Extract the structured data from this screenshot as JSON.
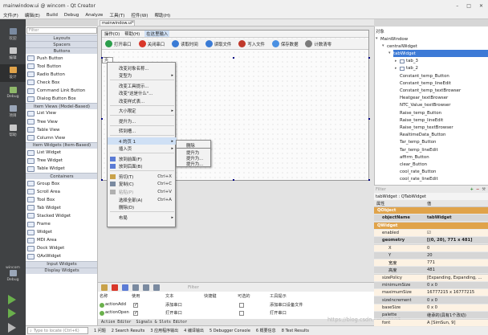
{
  "window": {
    "title": "mainwindow.ui @ wincom - Qt Creator"
  },
  "menubar": [
    "文件(F)",
    "编辑(E)",
    "Build",
    "Debug",
    "Analyze",
    "工具(T)",
    "控件(W)",
    "帮助(H)"
  ],
  "modes": [
    "欢迎",
    "编辑",
    "设计",
    "Debug",
    "项目",
    "帮助"
  ],
  "kit": {
    "project": "wincom",
    "config": "Debug"
  },
  "widgetbox": {
    "filter_placeholder": "Filter",
    "items": [
      {
        "t": "cat",
        "label": "Layouts"
      },
      {
        "t": "cat",
        "label": "Spacers"
      },
      {
        "t": "cat",
        "label": "Buttons"
      },
      {
        "t": "item",
        "label": "Push Button"
      },
      {
        "t": "item",
        "label": "Tool Button"
      },
      {
        "t": "item",
        "label": "Radio Button"
      },
      {
        "t": "item",
        "label": "Check Box"
      },
      {
        "t": "item",
        "label": "Command Link Button"
      },
      {
        "t": "item",
        "label": "Dialog Button Box"
      },
      {
        "t": "cat",
        "label": "Item Views (Model-Based)"
      },
      {
        "t": "item",
        "label": "List View"
      },
      {
        "t": "item",
        "label": "Tree View"
      },
      {
        "t": "item",
        "label": "Table View"
      },
      {
        "t": "item",
        "label": "Column View"
      },
      {
        "t": "cat",
        "label": "Item Widgets (Item-Based)"
      },
      {
        "t": "item",
        "label": "List Widget"
      },
      {
        "t": "item",
        "label": "Tree Widget"
      },
      {
        "t": "item",
        "label": "Table Widget"
      },
      {
        "t": "cat",
        "label": "Containers"
      },
      {
        "t": "item",
        "label": "Group Box"
      },
      {
        "t": "item",
        "label": "Scroll Area"
      },
      {
        "t": "item",
        "label": "Tool Box"
      },
      {
        "t": "item",
        "label": "Tab Widget"
      },
      {
        "t": "item",
        "label": "Stacked Widget"
      },
      {
        "t": "item",
        "label": "Frame"
      },
      {
        "t": "item",
        "label": "Widget"
      },
      {
        "t": "item",
        "label": "MDI Area"
      },
      {
        "t": "item",
        "label": "Dock Widget"
      },
      {
        "t": "item",
        "label": "QAxWidget"
      },
      {
        "t": "cat",
        "label": "Input Widgets"
      },
      {
        "t": "cat",
        "label": "Display Widgets"
      }
    ]
  },
  "editor": {
    "doc_tab": "mainwindow.ui*",
    "form_menu": [
      "操作(O)",
      "帮助(H)",
      "在这里输入"
    ],
    "form_toolbar": [
      "打开串口",
      "关闭串口",
      "读取时间",
      "读取文件",
      "写入文件",
      "保存数据",
      "计数清零"
    ],
    "tab_label": "页"
  },
  "context_menu": {
    "items": [
      {
        "label": "改变对象名称...",
        "y": 0
      },
      {
        "label": "变型为",
        "y": 1,
        "sub": true
      },
      {
        "sep": true,
        "y": 2
      },
      {
        "label": "改变工具提示...",
        "y": 2.3
      },
      {
        "label": "改变\"这是什么\"...",
        "y": 3.3
      },
      {
        "label": "改变样式表...",
        "y": 4.3
      },
      {
        "sep": true,
        "y": 5.3
      },
      {
        "label": "大小限定",
        "y": 5.6,
        "sub": true
      },
      {
        "sep": true,
        "y": 6.6
      },
      {
        "label": "提升为...",
        "y": 6.9
      },
      {
        "sep": true,
        "y": 7.9
      },
      {
        "label": "转到槽...",
        "y": 8.2
      },
      {
        "sep": true,
        "y": 9.2
      },
      {
        "label": "4 的页 1",
        "y": 9.5,
        "sub": true,
        "hl": true
      },
      {
        "label": "插入页",
        "y": 10.5,
        "sub": true
      },
      {
        "sep": true,
        "y": 11.5
      },
      {
        "label": "放到前面(F)",
        "y": 11.8
      },
      {
        "label": "放到后面(B)",
        "y": 12.8
      },
      {
        "sep": true,
        "y": 13.8
      },
      {
        "label": "剪切(T)",
        "y": 14.1,
        "sc": "Ctrl+X"
      },
      {
        "label": "复制(C)",
        "y": 15.1,
        "sc": "Ctrl+C"
      },
      {
        "label": "粘贴(P)",
        "y": 16.1,
        "sc": "Ctrl+V",
        "dis": true
      },
      {
        "label": "选择全部(A)",
        "y": 17.1,
        "sc": "Ctrl+A"
      },
      {
        "label": "删除(D)",
        "y": 18.1
      },
      {
        "sep": true,
        "y": 19.1
      },
      {
        "label": "布局",
        "y": 19.4,
        "sub": true
      }
    ],
    "sub1": [
      "删除"
    ],
    "sub2": [
      "提升为",
      "提升为...",
      "提升为..."
    ]
  },
  "action_editor": {
    "filter_placeholder": "Filter",
    "columns": [
      "名称",
      "使用",
      "文本",
      "快捷键",
      "可选的",
      "工具提示"
    ],
    "rows": [
      {
        "name": "actionAdd",
        "used": true,
        "text": "添加串口",
        "tip": "添加串口设备文件"
      },
      {
        "name": "actionOpen",
        "used": true,
        "text": "打开串口",
        "tip": "打开串口"
      }
    ],
    "tabs": [
      "Action Editor",
      "Signals & Slots Editor"
    ]
  },
  "statusbar": {
    "locate_placeholder": "Type to locate (Ctrl+K)",
    "items": [
      "1 问题",
      "2 Search Results",
      "3 应用程序输出",
      "4 编译输出",
      "5 Debugger Console",
      "6 概要信息",
      "8 Test Results"
    ]
  },
  "object_inspector": {
    "header": "对象",
    "tree": [
      {
        "label": "MainWindow",
        "depth": 0,
        "twisty": "▾"
      },
      {
        "label": "centralWidget",
        "depth": 1,
        "twisty": "▾"
      },
      {
        "label": "tabWidget",
        "depth": 2,
        "twisty": "▾",
        "sel": true
      },
      {
        "label": "tab_3",
        "depth": 3,
        "twisty": "▸"
      },
      {
        "label": "tab_2",
        "depth": 3,
        "twisty": "▸"
      },
      {
        "label": "Constant_temp_Button",
        "depth": 3
      },
      {
        "label": "Constant_temp_lineEdit",
        "depth": 3
      },
      {
        "label": "Constant_temp_textBrowser",
        "depth": 3
      },
      {
        "label": "Heatgear_textBrowser",
        "depth": 3
      },
      {
        "label": "NTC_Value_textBrowser",
        "depth": 3
      },
      {
        "label": "Raise_temp_Button",
        "depth": 3
      },
      {
        "label": "Raise_temp_lineEdit",
        "depth": 3
      },
      {
        "label": "Raise_temp_textBrowser",
        "depth": 3
      },
      {
        "label": "RealtimeData_Button",
        "depth": 3
      },
      {
        "label": "Tar_temp_Button",
        "depth": 3
      },
      {
        "label": "Tar_temp_lineEdit",
        "depth": 3
      },
      {
        "label": "affirm_Button",
        "depth": 3
      },
      {
        "label": "clear_Button",
        "depth": 3
      },
      {
        "label": "cool_rate_Button",
        "depth": 3
      },
      {
        "label": "cool_rate_lineEdit",
        "depth": 3
      }
    ]
  },
  "property_editor": {
    "filter_placeholder": "Filter",
    "title": "tabWidget : QTabWidget",
    "header": [
      "属性",
      "值"
    ],
    "rows": [
      {
        "name": "QObject",
        "value": "",
        "grp": true
      },
      {
        "name": "objectName",
        "value": "tabWidget",
        "bold": true
      },
      {
        "name": "QWidget",
        "value": "",
        "grp": true
      },
      {
        "name": "enabled",
        "value": "☑",
        "alt": true
      },
      {
        "name": "geometry",
        "value": "[(0, 20), 771 x 481]",
        "bold": true
      },
      {
        "name": "X",
        "value": "0",
        "sub": true,
        "alt": true
      },
      {
        "name": "Y",
        "value": "20",
        "sub": true
      },
      {
        "name": "宽度",
        "value": "771",
        "sub": true,
        "alt": true
      },
      {
        "name": "高度",
        "value": "481",
        "sub": true
      },
      {
        "name": "sizePolicy",
        "value": "[Expanding, Expanding, ...",
        "alt": true
      },
      {
        "name": "minimumSize",
        "value": "0 x 0"
      },
      {
        "name": "maximumSize",
        "value": "16777215 x 16777215",
        "alt": true
      },
      {
        "name": "sizeIncrement",
        "value": "0 x 0"
      },
      {
        "name": "baseSize",
        "value": "0 x 0",
        "alt": true
      },
      {
        "name": "palette",
        "value": "继承的(具有1个改动)"
      },
      {
        "name": "font",
        "value": "A [SimSun, 9]",
        "alt": true
      }
    ]
  },
  "watermark": "https://blog.csdn.net/u0103...",
  "colors": {
    "modebar": "#404244",
    "selection": "#3d7ad6",
    "group_header": "#e0a34a"
  }
}
